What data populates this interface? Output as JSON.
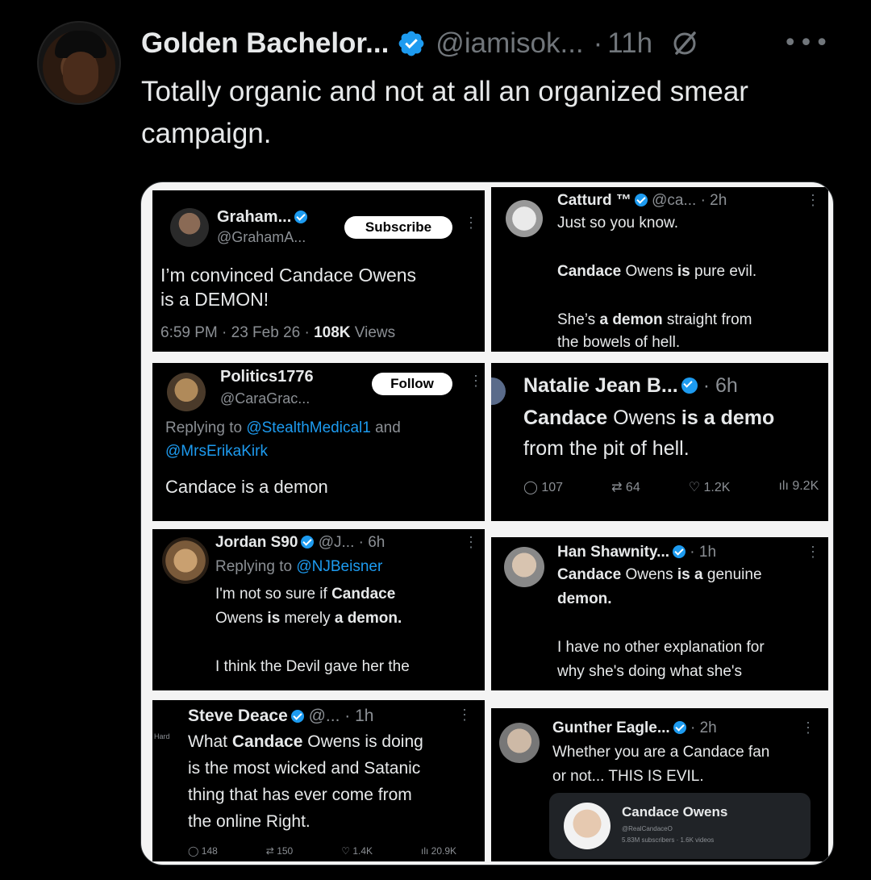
{
  "post": {
    "author_name": "Golden Bachelor...",
    "handle": "@iamisok...",
    "separator": "·",
    "time": "11h",
    "more": "•••",
    "text": "Totally organic and not at all an organized smear campaign."
  },
  "panels": {
    "graham": {
      "name": "Graham...",
      "handle": "@GrahamA...",
      "button": "Subscribe",
      "text_line1": "I’m convinced Candace Owens",
      "text_line2": "is a DEMON!",
      "meta_time": "6:59 PM · 23 Feb 26 · ",
      "meta_views": "108K",
      "meta_views_label": " Views"
    },
    "catturd": {
      "name": "Catturd ™",
      "handle": "@ca... · 2h",
      "line1": "Just so you know.",
      "line2_bold1": "Candace",
      "line2_plain1": " Owens ",
      "line2_bold2": "is",
      "line2_plain2": " pure evil.",
      "line3_plain1": "She’s ",
      "line3_bold": "a demon",
      "line3_plain2": " straight from",
      "line4": "the bowels of hell."
    },
    "politics": {
      "name": "Politics1776",
      "handle": "@CaraGrac...",
      "button": "Follow",
      "reply_prefix": "Replying to ",
      "reply_user1": "@StealthMedical1",
      "reply_and": " and",
      "reply_user2": "@MrsErikaKirk",
      "text": "Candace is a demon"
    },
    "natalie": {
      "name": "Natalie Jean B...",
      "time": "· 6h",
      "line1_bold1": "Candace",
      "line1_plain": " Owens ",
      "line1_bold2": "is a demo",
      "line2": "from the pit of hell.",
      "replies": "107",
      "retweets": "64",
      "likes": "1.2K",
      "views": "9.2K"
    },
    "jordan": {
      "name": "Jordan S90",
      "handle": "@J... · 6h",
      "reply_prefix": "Replying to ",
      "reply_user": "@NJBeisner",
      "line1_plain": "I'm not so sure if ",
      "line1_bold": "Candace",
      "line2_plain1": "Owens ",
      "line2_bold1": "is",
      "line2_plain2": " merely ",
      "line2_bold2": "a demon.",
      "line3": "I think the Devil gave her the"
    },
    "han": {
      "name": "Han Shawnity...",
      "time": "· 1h",
      "line1_bold1": "Candace",
      "line1_plain1": " Owens ",
      "line1_bold2": "is a",
      "line1_plain2": " genuine",
      "line2_bold": "demon.",
      "line3": "I have no other explanation for",
      "line4": "why she's doing what she's"
    },
    "steve": {
      "name": "Steve Deace",
      "handle": "@... · 1h",
      "line1_plain": "What ",
      "line1_bold": "Candace",
      "line1_plain2": " Owens is doing",
      "line2": "is the most wicked and Satanic",
      "line3": "thing that has ever come from",
      "line4": "the online Right.",
      "replies": "148",
      "retweets": "150",
      "likes": "1.4K",
      "views": "20.9K"
    },
    "gunther": {
      "name": "Gunther Eagle...",
      "time": "· 2h",
      "line1": "Whether you are a Candace fan",
      "line2": "or not... THIS IS EVIL.",
      "card_title": "Candace Owens",
      "card_handle": "@RealCandaceO",
      "card_meta": "5.83M subscribers · 1.6K videos"
    }
  },
  "colors": {
    "background": "#000000",
    "text": "#e7e9ea",
    "muted": "#71767b",
    "accent": "#1d9bf0"
  }
}
